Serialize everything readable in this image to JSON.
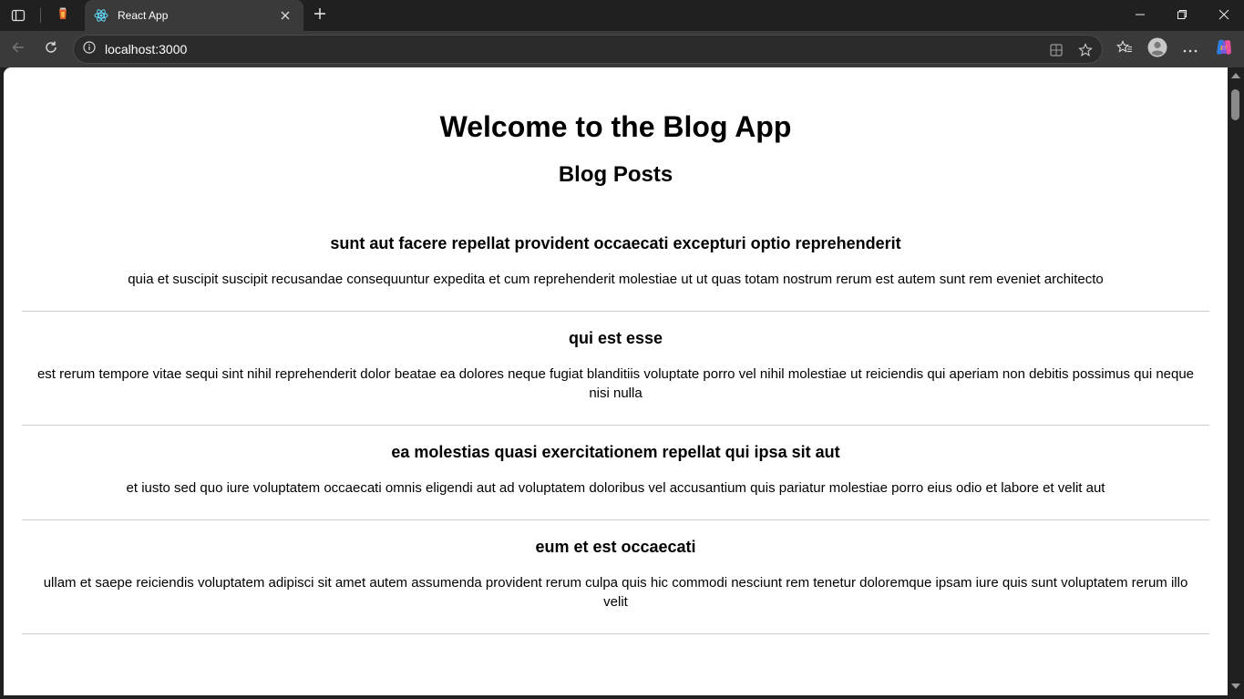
{
  "browser": {
    "tab_title": "React App",
    "url": "localhost:3000",
    "icons": {
      "tab_actions": "tab-actions-icon",
      "pinned_tab": "firefox-style-favicon",
      "active_favicon": "react-icon",
      "close": "close-icon",
      "new_tab": "plus-icon",
      "back": "back-arrow-icon",
      "reload": "reload-icon",
      "site_info": "info-icon",
      "app_available": "app-icon",
      "favorite": "star-icon",
      "favorites": "favorites-icon",
      "profile": "profile-icon",
      "more": "more-icon",
      "copilot": "copilot-icon"
    },
    "colors": {
      "frame": "#202020",
      "toolbar": "#3a3a3a",
      "page_bg": "#ffffff"
    }
  },
  "page": {
    "title": "Welcome to the Blog App",
    "subtitle": "Blog Posts",
    "posts": [
      {
        "title": "sunt aut facere repellat provident occaecati excepturi optio reprehenderit",
        "body": "quia et suscipit suscipit recusandae consequuntur expedita et cum reprehenderit molestiae ut ut quas totam nostrum rerum est autem sunt rem eveniet architecto"
      },
      {
        "title": "qui est esse",
        "body": "est rerum tempore vitae sequi sint nihil reprehenderit dolor beatae ea dolores neque fugiat blanditiis voluptate porro vel nihil molestiae ut reiciendis qui aperiam non debitis possimus qui neque nisi nulla"
      },
      {
        "title": "ea molestias quasi exercitationem repellat qui ipsa sit aut",
        "body": "et iusto sed quo iure voluptatem occaecati omnis eligendi aut ad voluptatem doloribus vel accusantium quis pariatur molestiae porro eius odio et labore et velit aut"
      },
      {
        "title": "eum et est occaecati",
        "body": "ullam et saepe reiciendis voluptatem adipisci sit amet autem assumenda provident rerum culpa quis hic commodi nesciunt rem tenetur doloremque ipsam iure quis sunt voluptatem rerum illo velit"
      }
    ]
  }
}
